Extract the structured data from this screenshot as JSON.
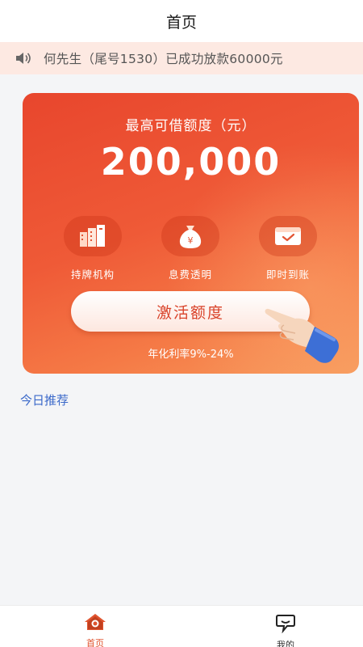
{
  "navbar": {
    "title": "首页"
  },
  "notice": {
    "icon": "speaker-icon",
    "text": "何先生（尾号1530）已成功放款60000元"
  },
  "loan_card": {
    "label": "最高可借额度（元）",
    "amount": "200,000",
    "features": [
      {
        "icon": "building-icon",
        "label": "持牌机构"
      },
      {
        "icon": "money-bag-icon",
        "label": "息费透明"
      },
      {
        "icon": "envelope-check-icon",
        "label": "即时到账"
      }
    ],
    "cta_label": "激活额度",
    "rate_text": "年化利率9%-24%"
  },
  "recommend": {
    "title": "今日推荐"
  },
  "tabbar": {
    "items": [
      {
        "label": "首页",
        "icon": "home-icon",
        "active": true
      },
      {
        "label": "我的",
        "icon": "user-icon",
        "active": false
      }
    ]
  },
  "colors": {
    "accent": "#e8462d",
    "notice_bg": "#fde9e2",
    "link": "#3a68c9"
  }
}
